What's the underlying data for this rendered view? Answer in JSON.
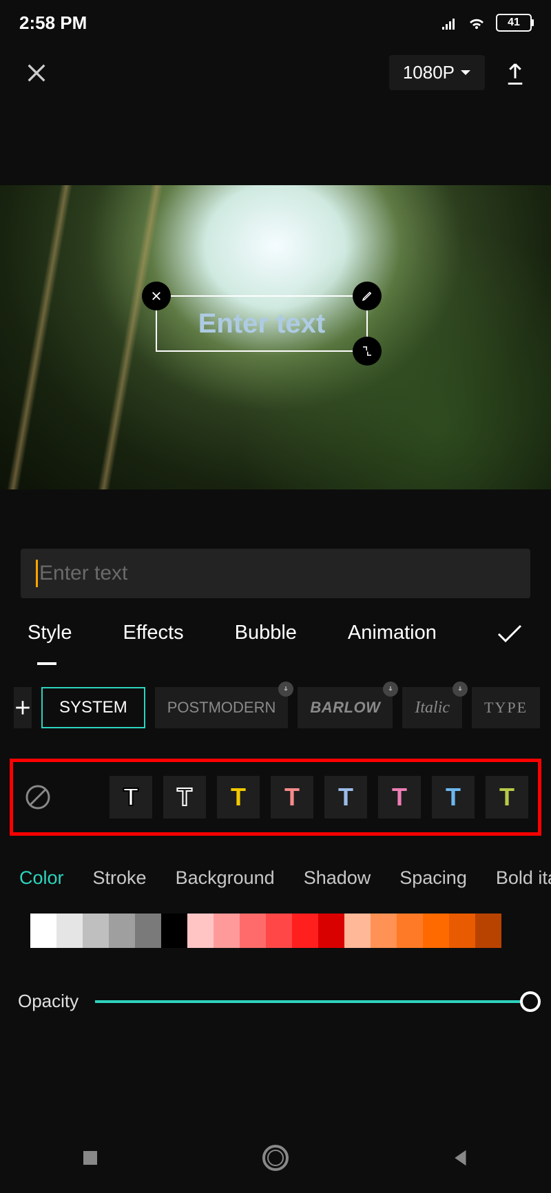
{
  "statusbar": {
    "time": "2:58 PM",
    "battery": "41"
  },
  "header": {
    "resolution": "1080P"
  },
  "preview": {
    "text_placeholder": "Enter text"
  },
  "input": {
    "placeholder": "Enter text"
  },
  "main_tabs": {
    "style": "Style",
    "effects": "Effects",
    "bubble": "Bubble",
    "animation": "Animation"
  },
  "fonts": {
    "system": "SYSTEM",
    "postmodern": "POSTMODERN",
    "barlow": "BARLOW",
    "italic": "Italic",
    "type": "TYPE"
  },
  "presets": {
    "letter": "T",
    "colors": [
      "#ffffff",
      "#ffffff",
      "#f2c900",
      "#f58b8b",
      "#9bbce8",
      "#ee7eb6",
      "#6db8ee",
      "#b9c94a"
    ],
    "strokes": [
      "#000000",
      "none",
      "none",
      "none",
      "none",
      "none",
      "none",
      "none"
    ],
    "outline_only": [
      false,
      true,
      false,
      false,
      false,
      false,
      false,
      false
    ]
  },
  "sub_tabs": {
    "color": "Color",
    "stroke": "Stroke",
    "background": "Background",
    "shadow": "Shadow",
    "spacing": "Spacing",
    "bold_italic": "Bold ital"
  },
  "palette": [
    "#ffffff",
    "#e5e5e5",
    "#bfbfbf",
    "#9f9f9f",
    "#7a7a7a",
    "#000000",
    "#ffc5c5",
    "#ff9a9a",
    "#ff6b6b",
    "#ff4747",
    "#ff1f1f",
    "#d90000",
    "#ffb999",
    "#ff9254",
    "#ff7a26",
    "#ff6a00",
    "#e85b00",
    "#b84300"
  ],
  "opacity": {
    "label": "Opacity"
  }
}
